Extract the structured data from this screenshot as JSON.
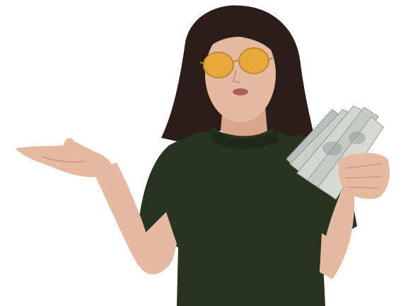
{
  "image": {
    "subject": "woman",
    "colors": {
      "background": "#ffffff",
      "hair": "#2b1d17",
      "skin": "#e6b9a1",
      "skin_shadow": "#c9937a",
      "shirt": "#27341f",
      "shirt_shadow": "#1a2315",
      "lens": "#e8a93a",
      "frame": "#b8893a",
      "money": "#c9d0c8",
      "money_dark": "#8e9a92"
    }
  }
}
